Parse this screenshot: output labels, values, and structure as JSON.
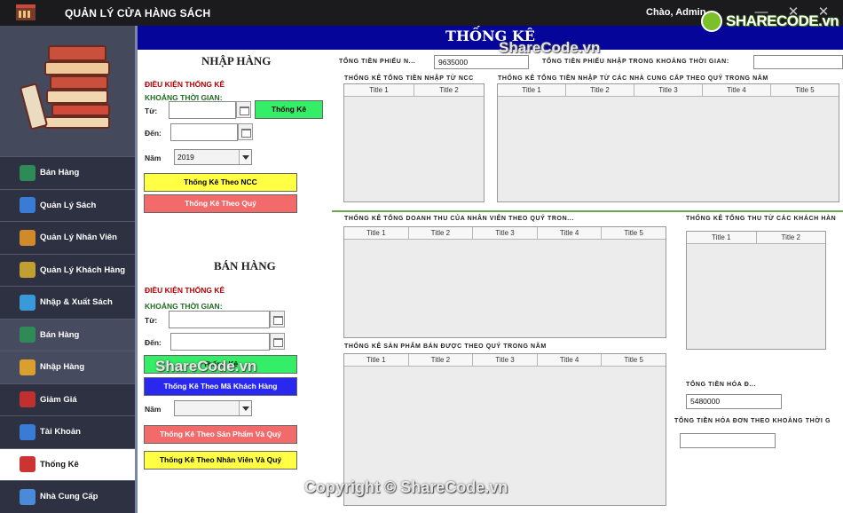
{
  "window": {
    "title": "QUẢN LÝ CỬA HÀNG SÁCH",
    "greeting": "Chào,  Admin",
    "controls": [
      "minimize-icon",
      "restore-icon",
      "close-icon"
    ]
  },
  "watermark": {
    "logo_text": "SHARECODE.vn",
    "header_text": "ShareCode.vn",
    "button_text": "ShareCode.vn",
    "copyright": "Copyright © ShareCode.vn"
  },
  "sidebar": {
    "items": [
      {
        "label": "Bán Hàng",
        "icon": "cart-icon",
        "color": "#2e8b57"
      },
      {
        "label": "Quản Lý Sách",
        "icon": "book-icon",
        "color": "#3a7bd5"
      },
      {
        "label": "Quản Lý Nhân Viên",
        "icon": "staff-icon",
        "color": "#d08a2a"
      },
      {
        "label": "Quản Lý Khách Hàng",
        "icon": "customer-icon",
        "color": "#c0a030"
      },
      {
        "label": "Nhập & Xuất Sách",
        "icon": "transfer-icon",
        "color": "#3a9ad9"
      },
      {
        "label": "Bán Hàng",
        "icon": "cart-icon",
        "color": "#2e8b57"
      },
      {
        "label": "Nhập Hàng",
        "icon": "import-icon",
        "color": "#d9a030"
      },
      {
        "label": "Giảm Giá",
        "icon": "discount-icon",
        "color": "#c03030"
      },
      {
        "label": "Tài Khoản",
        "icon": "account-icon",
        "color": "#3a7bd5"
      },
      {
        "label": "Thống Kê",
        "icon": "chart-icon",
        "color": "#cc3333"
      },
      {
        "label": "Nhà Cung Cấp",
        "icon": "supplier-icon",
        "color": "#4a8ad9"
      }
    ],
    "active_index": 9
  },
  "header": {
    "title": "THỐNG KÊ"
  },
  "import_panel": {
    "title": "NHẬP HÀNG",
    "condition": "ĐIỀU KIỆN THỐNG KÊ",
    "period": "KHOẢNG THỜI GIAN:",
    "from_label": "Từ:",
    "to_label": "Đến:",
    "from_value": "",
    "to_value": "",
    "stat_button": "Thống Kê",
    "year_label": "Năm",
    "year_value": "2019",
    "by_supplier_button": "Thống Kê Theo NCC",
    "by_quarter_button": "Thống Kê Theo Quý"
  },
  "sales_panel": {
    "title": "BÁN HÀNG",
    "condition": "ĐIỀU KIỆN THỐNG KÊ",
    "period": "KHOẢNG THỜI GIAN:",
    "from_label": "Từ:",
    "to_label": "Đến:",
    "from_value": "",
    "to_value": "",
    "stat_button": "Thống Kê",
    "by_customer_button": "Thống Kê Theo Mã Khách Hàng",
    "year_label": "Năm",
    "year_value": "",
    "by_product_button": "Thống Kê Theo Sản Phẩm Và Quý",
    "by_employee_button": "Thống Kê Theo Nhân Viên Và Quý"
  },
  "summary": {
    "total_import_label": "TỔNG TIỀN PHIẾU N...",
    "total_import_value": "9635000",
    "total_import_period_label": "TỔNG TIỀN PHIẾU NHẬP TRONG KHOẢNG THỜI GIAN:",
    "total_import_period_value": "",
    "total_invoice_label": "TỔNG TIỀN HÓA Đ...",
    "total_invoice_value": "5480000",
    "total_invoice_period_label": "TỔNG TIỀN HÓA ĐƠN THEO KHOẢNG THỜI G",
    "total_invoice_period_value": ""
  },
  "tables": {
    "supplier_total": {
      "caption": "THỐNG KÊ TỔNG TIỀN NHẬP TỪ NCC",
      "columns": [
        "Title 1",
        "Title 2"
      ]
    },
    "supplier_quarter": {
      "caption": "THỐNG KÊ TỔNG TIỀN NHẬP TỪ CÁC NHÀ CUNG CẤP THEO QUÝ TRONG NĂM",
      "columns": [
        "Title 1",
        "Title 2",
        "Title 3",
        "Title 4",
        "Title 5"
      ]
    },
    "employee_revenue": {
      "caption": "THỐNG KÊ TỔNG  DOANH THU CỦA NHÂN VIÊN THEO QUÝ TRON...",
      "columns": [
        "Title 1",
        "Title 2",
        "Title 3",
        "Title 4",
        "Title 5"
      ]
    },
    "customer_total": {
      "caption": "THỐNG KÊ TỔNG THU TỪ CÁC KHÁCH HÀN",
      "columns": [
        "Title 1",
        "Title 2"
      ]
    },
    "product_sales": {
      "caption": "THỐNG KÊ SẢN PHẨM BÁN ĐƯỢC THEO QUÝ TRONG NĂM",
      "columns": [
        "Title 1",
        "Title 2",
        "Title 3",
        "Title 4",
        "Title 5"
      ]
    }
  }
}
